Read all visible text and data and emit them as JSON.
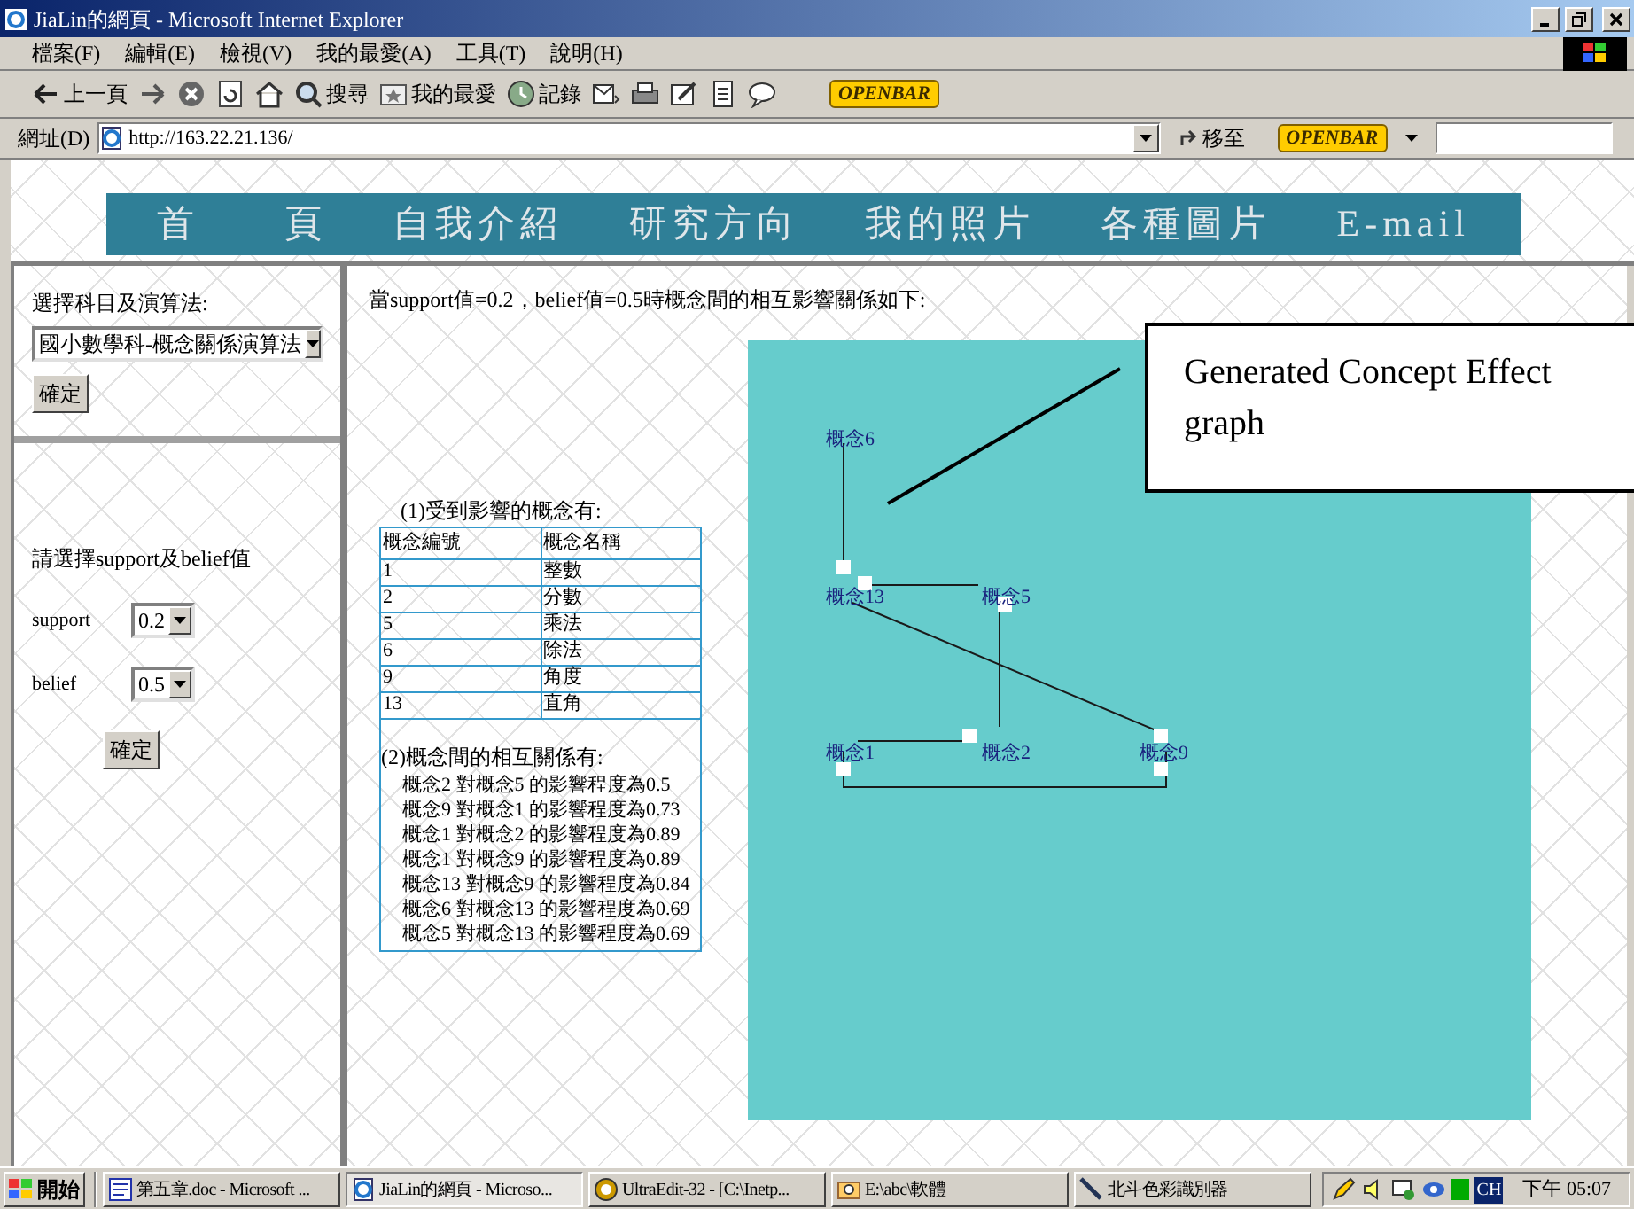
{
  "window": {
    "title": "JiaLin的網頁 - Microsoft Internet Explorer"
  },
  "menu": [
    "檔案(F)",
    "編輯(E)",
    "檢視(V)",
    "我的最愛(A)",
    "工具(T)",
    "說明(H)"
  ],
  "toolbar": [
    {
      "kind": "back",
      "label": "上一頁"
    },
    {
      "kind": "forward"
    },
    {
      "kind": "stop"
    },
    {
      "kind": "refresh"
    },
    {
      "kind": "home"
    },
    {
      "kind": "search",
      "label": "搜尋"
    },
    {
      "kind": "favorites",
      "label": "我的最愛"
    },
    {
      "kind": "history",
      "label": "記錄"
    },
    {
      "kind": "mail"
    },
    {
      "kind": "print"
    },
    {
      "kind": "edit"
    },
    {
      "kind": "doc"
    },
    {
      "kind": "chat"
    },
    {
      "kind": "logo",
      "label": "OPENBAR"
    }
  ],
  "address": {
    "label": "網址(D)",
    "value": "http://163.22.21.136/",
    "go": "移至",
    "logo": "OPENBAR"
  },
  "banner": [
    "首　　頁",
    "自我介紹",
    "研究方向",
    "我的照片",
    "各種圖片",
    "E-mail"
  ],
  "subject_form": {
    "label": "選擇科目及演算法:",
    "value": "國小數學科-概念關係演算法",
    "button": "確定"
  },
  "threshold_form": {
    "title": "請選擇support及belief值",
    "fields": [
      {
        "label": "support",
        "value": "0.2"
      },
      {
        "label": "belief",
        "value": "0.5"
      }
    ],
    "button": "確定"
  },
  "result": {
    "heading": "當support值=0.2，belief值=0.5時概念間的相互影響關係如下:",
    "caption": "(1)受到影響的概念有:",
    "columns": [
      "概念編號",
      "概念名稱"
    ],
    "rows": [
      [
        "1",
        "整數"
      ],
      [
        "2",
        "分數"
      ],
      [
        "5",
        "乘法"
      ],
      [
        "6",
        "除法"
      ],
      [
        "9",
        "角度"
      ],
      [
        "13",
        "直角"
      ]
    ],
    "relations_title": "(2)概念間的相互關係有:",
    "relations": [
      "概念2 對概念5 的影響程度為0.5",
      "概念9 對概念1 的影響程度為0.73",
      "概念1 對概念2 的影響程度為0.89",
      "概念1 對概念9 的影響程度為0.89",
      "概念13 對概念9 的影響程度為0.84",
      "概念6 對概念13 的影響程度為0.69",
      "概念5 對概念13 的影響程度為0.69"
    ]
  },
  "graph": {
    "nodes": [
      "概念6",
      "概念13",
      "概念5",
      "概念1",
      "概念2",
      "概念9"
    ]
  },
  "callout": "Generated Concept Effect graph",
  "taskbar": {
    "start": "開始",
    "tasks": [
      {
        "label": "第五章.doc - Microsoft ...",
        "kind": "word",
        "selected": false
      },
      {
        "label": "JiaLin的網頁 - Microso...",
        "kind": "ie",
        "selected": true
      },
      {
        "label": "UltraEdit-32 - [C:\\Inetp...",
        "kind": "ue",
        "selected": false
      },
      {
        "label": "E:\\abc\\軟體",
        "kind": "folder",
        "selected": false
      },
      {
        "label": "北斗色彩識別器",
        "kind": "pen",
        "selected": false
      }
    ],
    "lang": "CH",
    "time": "下午 05:07"
  }
}
